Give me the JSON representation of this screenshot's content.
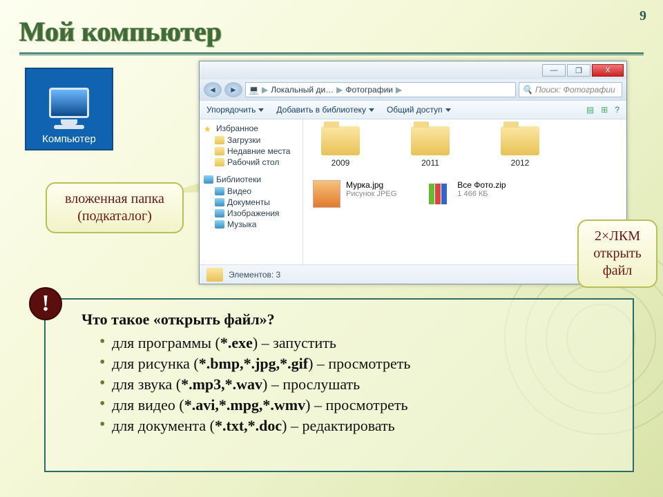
{
  "page_number": "9",
  "title": "Мой компьютер",
  "computer_icon_label": "Компьютер",
  "window": {
    "controls": {
      "min": "—",
      "max": "❐",
      "close": "X"
    },
    "nav": {
      "back": "◄",
      "fwd": "►"
    },
    "breadcrumb": {
      "root_icon": "💻",
      "part1": "Локальный ди…",
      "sep": "▶",
      "part2": "Фотографии",
      "sep2": "▶"
    },
    "search_placeholder": "Поиск: Фотографии",
    "toolbar": {
      "organize": "Упорядочить",
      "add_lib": "Добавить в библиотеку",
      "share": "Общий доступ",
      "right_icons": [
        "▤",
        "⊞",
        "?"
      ]
    },
    "sidebar": {
      "favorites": {
        "label": "Избранное",
        "items": [
          "Загрузки",
          "Недавние места",
          "Рабочий стол"
        ]
      },
      "libraries": {
        "label": "Библиотеки",
        "items": [
          "Видео",
          "Документы",
          "Изображения",
          "Музыка"
        ]
      }
    },
    "folders": [
      "2009",
      "2011",
      "2012"
    ],
    "files": [
      {
        "name": "Мурка.jpg",
        "meta": "Рисунок JPEG"
      },
      {
        "name": "Все Фото.zip",
        "meta": "1 466 КБ"
      }
    ],
    "status": "Элементов: 3"
  },
  "callout_subfolder": {
    "l1": "вложенная папка",
    "l2": "(подкаталог)"
  },
  "callout_open": {
    "l1": "2×ЛКМ",
    "l2": "открыть",
    "l3": "файл"
  },
  "badge": "!",
  "info": {
    "heading": "Что такое «открыть файл»?",
    "items": [
      {
        "pre": "для программы (",
        "ext": "*.exe",
        "post": ") – запустить"
      },
      {
        "pre": "для рисунка (",
        "ext": "*.bmp,*.jpg,*.gif",
        "post": ") – просмотреть"
      },
      {
        "pre": "для звука (",
        "ext": "*.mp3,*.wav",
        "post": ") – прослушать"
      },
      {
        "pre": "для видео (",
        "ext": "*.avi,*.mpg,*.wmv",
        "post": ") – просмотреть"
      },
      {
        "pre": "для документа (",
        "ext": "*.txt,*.doc",
        "post": ") – редактировать"
      }
    ]
  }
}
